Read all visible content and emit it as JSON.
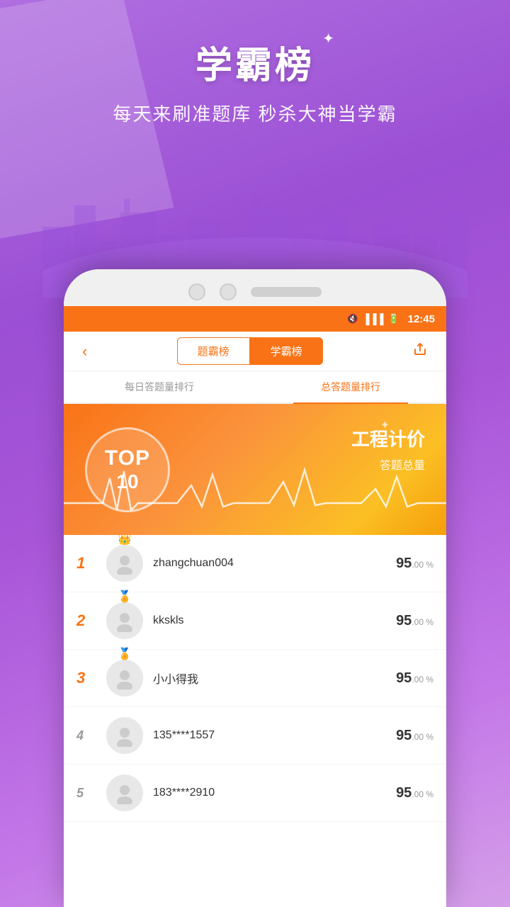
{
  "background": {
    "gradient_start": "#b06ee0",
    "gradient_end": "#d49ee8"
  },
  "header": {
    "title": "学霸榜",
    "subtitle": "每天来刷准题库 秒杀大神当学霸",
    "sparkle": "✦"
  },
  "status_bar": {
    "time": "12:45",
    "mute_icon": "🔇",
    "signal_icon": "📶",
    "battery_icon": "🔋"
  },
  "nav": {
    "back_label": "‹",
    "tab1_label": "题霸榜",
    "tab2_label": "学霸榜",
    "share_icon": "↗",
    "active_tab": "tab2"
  },
  "sub_tabs": {
    "tab1_label": "每日答题量排行",
    "tab2_label": "总答题量排行",
    "active": "tab2"
  },
  "banner": {
    "top_label": "TOP",
    "top_num": "10",
    "category": "工程计价",
    "description": "答题总量"
  },
  "leaderboard": {
    "items": [
      {
        "rank": "1",
        "rank_class": "rank-1",
        "name": "zhangchuan004",
        "score_big": "95",
        "score_small": ".00",
        "score_suffix": "%",
        "has_crown": true,
        "crown": "👑"
      },
      {
        "rank": "2",
        "rank_class": "rank-2",
        "name": "kkskls",
        "score_big": "95",
        "score_small": ".00",
        "score_suffix": "%",
        "has_crown": true,
        "crown": "🏅"
      },
      {
        "rank": "3",
        "rank_class": "rank-3",
        "name": "小小得我",
        "score_big": "95",
        "score_small": ".00",
        "score_suffix": "%",
        "has_crown": true,
        "crown": "🏅"
      },
      {
        "rank": "4",
        "rank_class": "rank-4",
        "name": "135****1557",
        "score_big": "95",
        "score_small": ".00",
        "score_suffix": "%",
        "has_crown": false,
        "crown": ""
      },
      {
        "rank": "5",
        "rank_class": "rank-5",
        "name": "183****2910",
        "score_big": "95",
        "score_small": ".00",
        "score_suffix": "%",
        "has_crown": false,
        "crown": ""
      }
    ]
  }
}
